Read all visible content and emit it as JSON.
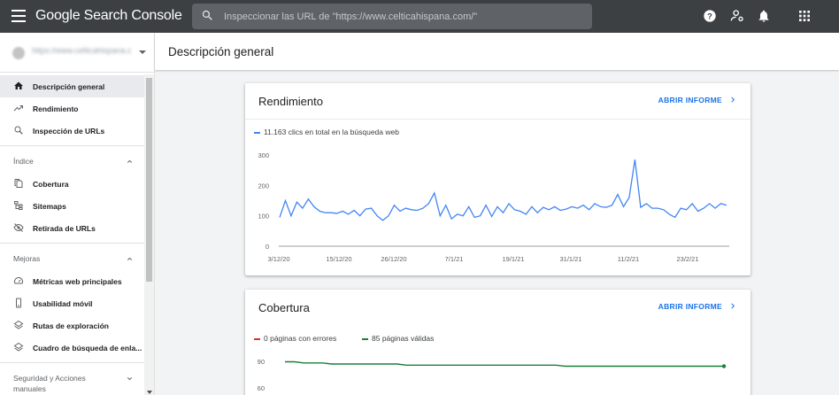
{
  "app": {
    "title": "Google Search Console"
  },
  "search": {
    "placeholder": "Inspeccionar las URL de \"https://www.celticahispana.com/\""
  },
  "toolbar_icons": [
    "help-icon",
    "account-manage-icon",
    "notifications-icon",
    "apps-grid-icon"
  ],
  "property": {
    "url": "https://www.celticahispana.com/"
  },
  "sidebar": {
    "main_items": [
      {
        "label": "Descripción general",
        "icon": "home-icon",
        "active": true
      },
      {
        "label": "Rendimiento",
        "icon": "trending-up-icon"
      },
      {
        "label": "Inspección de URLs",
        "icon": "search-icon"
      }
    ],
    "index": {
      "title": "Índice",
      "items": [
        {
          "label": "Cobertura",
          "icon": "file-copy-icon"
        },
        {
          "label": "Sitemaps",
          "icon": "sitemap-icon"
        },
        {
          "label": "Retirada de URLs",
          "icon": "visibility-off-icon"
        }
      ]
    },
    "improvements": {
      "title": "Mejoras",
      "items": [
        {
          "label": "Métricas web principales",
          "icon": "speed-gauge-icon"
        },
        {
          "label": "Usabilidad móvil",
          "icon": "phone-icon"
        },
        {
          "label": "Rutas de exploración",
          "icon": "layers-icon"
        },
        {
          "label": "Cuadro de búsqueda de enla...",
          "icon": "layers-icon"
        }
      ]
    },
    "security": {
      "title": "Seguridad y Acciones manuales"
    }
  },
  "page": {
    "title": "Descripción general"
  },
  "performance": {
    "title": "Rendimiento",
    "open_report": "ABRIR INFORME",
    "legend": "11.163 clics en total en la búsqueda web",
    "color": "#4285f4"
  },
  "coverage": {
    "title": "Cobertura",
    "open_report": "ABRIR INFORME",
    "legend_errors": "0 páginas con errores",
    "legend_valid": "85 páginas válidas",
    "error_color": "#d93025",
    "valid_color": "#188038"
  },
  "chart_data": [
    {
      "type": "line",
      "title": "",
      "ylim": [
        0,
        300
      ],
      "yticks": [
        0,
        100,
        200,
        300
      ],
      "xticks": [
        "3/12/20",
        "15/12/20",
        "26/12/20",
        "7/1/21",
        "19/1/21",
        "31/1/21",
        "11/2/21",
        "23/2/21"
      ],
      "series": [
        {
          "name": "11.163 clics en total en la búsqueda web",
          "values": [
            95,
            150,
            100,
            145,
            125,
            155,
            130,
            115,
            110,
            110,
            108,
            115,
            105,
            118,
            100,
            122,
            125,
            100,
            85,
            100,
            135,
            115,
            125,
            120,
            118,
            125,
            140,
            175,
            100,
            135,
            90,
            105,
            100,
            130,
            95,
            100,
            135,
            98,
            130,
            110,
            140,
            120,
            115,
            105,
            130,
            110,
            128,
            120,
            130,
            118,
            122,
            130,
            125,
            135,
            120,
            140,
            130,
            128,
            135,
            170,
            130,
            160,
            285,
            128,
            140,
            125,
            125,
            120,
            105,
            95,
            125,
            120,
            140,
            115,
            125,
            140,
            125,
            140,
            135
          ]
        }
      ],
      "grid": false
    },
    {
      "type": "line",
      "title": "",
      "yticks": [
        60,
        90
      ],
      "series": [
        {
          "name": "85 páginas válidas",
          "values": [
            89,
            89,
            88,
            88,
            88,
            87,
            87,
            87,
            87,
            87,
            87,
            87,
            87,
            86,
            86,
            86,
            86,
            86,
            86,
            86,
            86,
            86,
            86,
            86,
            86,
            86,
            86,
            86,
            86,
            86,
            85,
            85,
            85,
            85,
            85,
            85,
            85,
            85,
            85,
            85,
            85,
            85,
            85,
            85,
            85,
            85,
            85,
            85
          ]
        },
        {
          "name": "0 páginas con errores",
          "values": [
            0
          ]
        }
      ]
    }
  ]
}
